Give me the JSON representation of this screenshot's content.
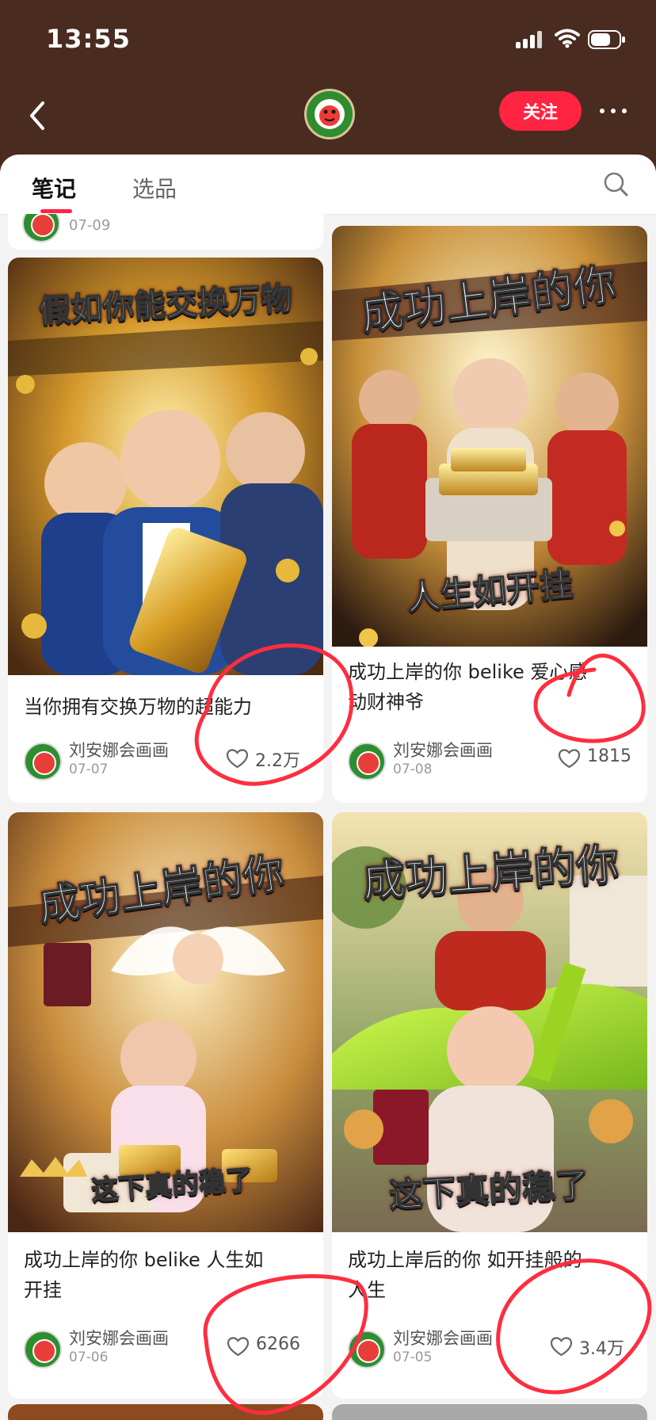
{
  "status_bar": {
    "time": "13:55"
  },
  "header": {
    "follow_label": "关注"
  },
  "tabs": {
    "notes_label": "笔记",
    "products_label": "选品"
  },
  "partial_card": {
    "date": "07-09"
  },
  "cards": [
    {
      "image_headline": "假如你能交换万物",
      "image_subtext": "",
      "title": "当你拥有交换万物的超能力",
      "author": "刘安娜会画画",
      "date": "07-07",
      "likes": "2.2万"
    },
    {
      "image_headline": "成功上岸的你",
      "image_subtext": "人生如开挂",
      "title": "成功上岸的你 belike 爱心感\n动财神爷",
      "author": "刘安娜会画画",
      "date": "07-08",
      "likes": "1815"
    },
    {
      "image_headline": "成功上岸的你",
      "image_subtext": "这下真的稳了",
      "title": "成功上岸的你 belike 人生如\n开挂",
      "author": "刘安娜会画画",
      "date": "07-06",
      "likes": "6266"
    },
    {
      "image_headline": "成功上岸的你",
      "image_subtext": "这下真的稳了",
      "title": "成功上岸后的你 如开挂般的\n人生",
      "author": "刘安娜会画画",
      "date": "07-05",
      "likes": "3.4万"
    }
  ],
  "colors": {
    "header_bg": "#4a2b1f",
    "accent": "#ff2442",
    "page_bg": "#f3f3f3"
  }
}
